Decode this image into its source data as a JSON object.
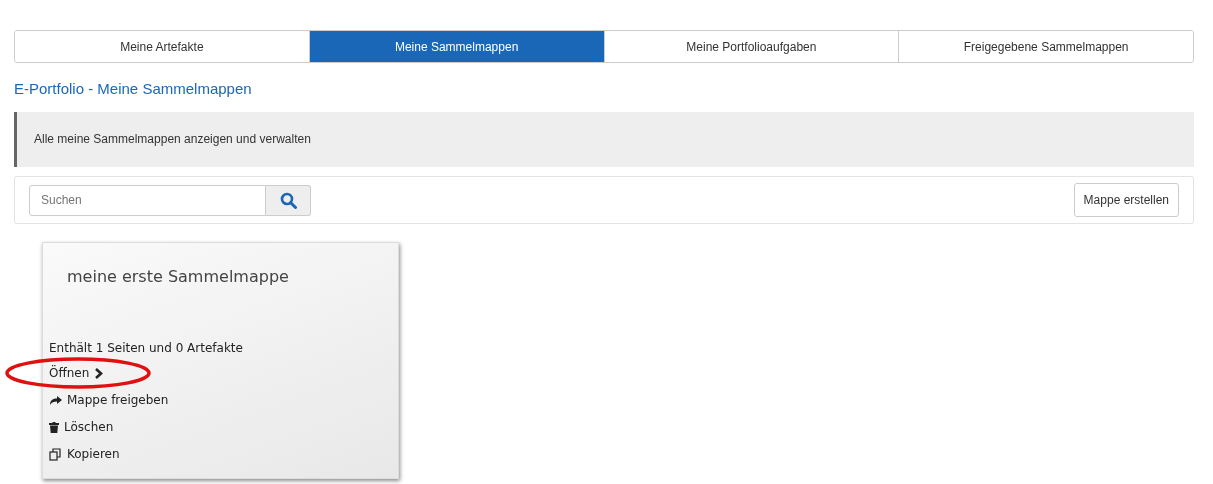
{
  "tabs": [
    {
      "label": "Meine Artefakte",
      "selected": false
    },
    {
      "label": "Meine Sammelmappen",
      "selected": true
    },
    {
      "label": "Meine Portfolioaufgaben",
      "selected": false
    },
    {
      "label": "Freigegebene Sammelmappen",
      "selected": false
    }
  ],
  "heading": "E-Portfolio - Meine Sammelmappen",
  "info": "Alle meine Sammelmappen anzeigen und verwalten",
  "search": {
    "placeholder": "Suchen"
  },
  "create_button": "Mappe erstellen",
  "folders": [
    {
      "title": "meine erste Sammelmappe",
      "summary": "Enthält 1 Seiten und 0 Artefakte",
      "actions": [
        {
          "kind": "open",
          "label": "Öffnen",
          "circled": true
        },
        {
          "kind": "share",
          "label": "Mappe freigeben",
          "circled": false
        },
        {
          "kind": "delete",
          "label": "Löschen",
          "circled": false
        },
        {
          "kind": "copy",
          "label": "Kopieren",
          "circled": false
        }
      ]
    }
  ]
}
